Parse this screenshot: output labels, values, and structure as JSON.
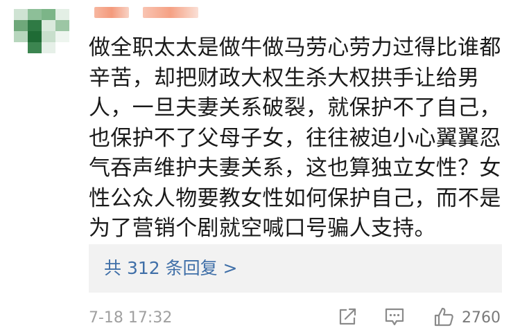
{
  "comment": {
    "text": "做全职太太是做牛做马劳心劳力过得比谁都\n辛苦，却把财政大权生杀大权拱手让给男\n人，一旦夫妻关系破裂，就保护不了自己，\n也保护不了父母子女，往往被迫小心翼翼忍\n气吞声维护夫妻关系，这也算独立女性？女\n性公众人物要教女性如何保护自己，而不是\n为了营销个剧就空喊口号骗人支持。",
    "replies_label": "共 312 条回复 >",
    "timestamp": "7-18 17:32",
    "like_count": "2760"
  },
  "icons": {
    "share": "share-icon",
    "reply": "comment-icon",
    "like": "thumbs-up-icon"
  },
  "colors": {
    "text": "#1a1a1a",
    "link": "#3f6fa8",
    "meta": "#a0a0a0",
    "replies_bg": "#f2f2f2"
  }
}
